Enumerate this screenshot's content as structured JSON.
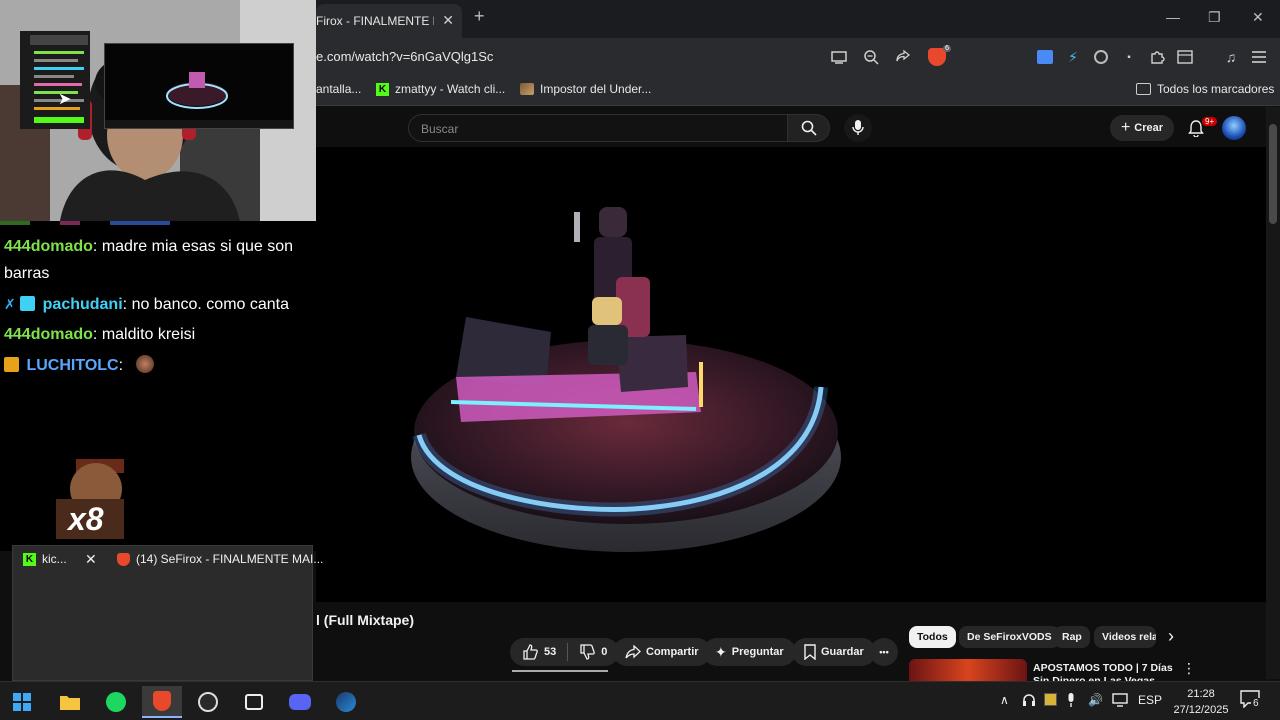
{
  "browser": {
    "tab_title": "Firox - FINALMENTE M",
    "tab_close": "✕",
    "new_tab": "+",
    "url": "e.com/watch?v=6nGaVQlg1Sc",
    "brave_badge": "6",
    "window_controls": {
      "minimize": "—",
      "restore": "❐",
      "close": "✕"
    }
  },
  "bookmarks": {
    "items": [
      {
        "label": "antalla...",
        "icon": "none"
      },
      {
        "label": "zmattyy - Watch cli...",
        "icon": "kick-icon"
      },
      {
        "label": "Impostor del Under...",
        "icon": "image-icon"
      }
    ],
    "all_bookmarks": "Todos los marcadores"
  },
  "youtube": {
    "search_placeholder": "Buscar",
    "create_label": "Crear",
    "notifications_badge": "9+",
    "video_title": "l (Full Mixtape)",
    "likes": "53",
    "dislikes": "0",
    "share_label": "Compartir",
    "ask_label": "Preguntar",
    "save_label": "Guardar",
    "more_label": "•••",
    "chips": [
      "Todos",
      "De SeFiroxVODS",
      "Rap",
      "Videos rela"
    ],
    "chip_next": "›",
    "rec_title": "APOSTAMOS TODO | 7 Días Sin Dinero en Las Vegas",
    "rec_menu": "⋮"
  },
  "chat": {
    "top_partial": "",
    "messages": [
      {
        "user": "444domado",
        "text": "madre mia esas si que son barras",
        "user_color": "#7ee34a",
        "badges": []
      },
      {
        "user": "pachudani",
        "text": "no banco. como canta",
        "user_color": "#3fd1f5",
        "badges": [
          "#2fb3f5",
          "#3fd1f5"
        ]
      },
      {
        "user": "444domado",
        "text": "maldito kreisi",
        "user_color": "#7ee34a",
        "badges": []
      },
      {
        "user": "LUCHITOLC",
        "text": "",
        "user_color": "#5aa6ff",
        "badges": [
          "#e8a21a"
        ]
      }
    ],
    "separator": ":",
    "emote_multiplier": "x8"
  },
  "preview": {
    "kick_title": "kic...",
    "kick_close": "✕",
    "brave_title": "(14) SeFirox - FINALMENTE MAI..."
  },
  "taskbar": {
    "apps": [
      "windows-start",
      "file-explorer",
      "spotify",
      "brave",
      "obs",
      "steam-client",
      "discord",
      "steam"
    ],
    "active_app": "brave",
    "language": "ESP",
    "time": "21:28",
    "date": "27/12/2025",
    "notifications_count": "6",
    "tray_chevron": "∧"
  },
  "colors": {
    "kick_green": "#53fc18",
    "youtube_bg": "#0f0f0f",
    "brave_orange": "#e8492c",
    "notification_red": "#cc0000"
  }
}
